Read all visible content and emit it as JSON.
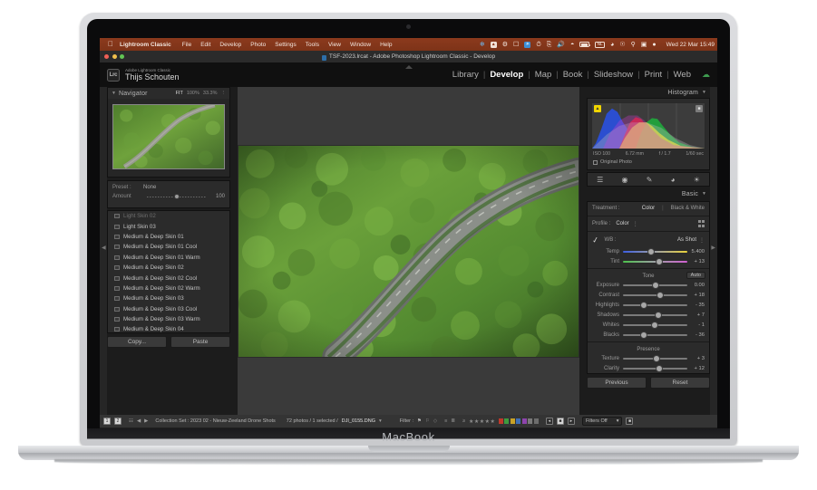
{
  "device": {
    "brand": "MacBook"
  },
  "menubar": {
    "apple_icon": "apple-icon",
    "app_name": "Lightroom Classic",
    "items": [
      "File",
      "Edit",
      "Develop",
      "Photo",
      "Settings",
      "Tools",
      "View",
      "Window",
      "Help"
    ],
    "status_icons": [
      "butterfly-icon",
      "dropbox-icon",
      "bluetooth-alt-icon",
      "screenshot-icon",
      "onedrive-icon",
      "timemachine-icon",
      "clipboard-icon",
      "volume-icon",
      "bluetooth-icon",
      "battery-icon",
      "input-language-nl",
      "wifi-icon",
      "controlcenter-icon",
      "search-icon",
      "displays-icon",
      "siri-icon"
    ],
    "input_language": "NL",
    "clock": "Wed 22 Mar  15:49"
  },
  "titlebar": {
    "title": "TSF-2023.lrcat - Adobe Photoshop Lightroom Classic - Develop"
  },
  "identity": {
    "logo_text": "Lrc",
    "product": "Adobe Lightroom Classic",
    "user": "Thijs Schouten"
  },
  "modules": {
    "items": [
      "Library",
      "Develop",
      "Map",
      "Book",
      "Slideshow",
      "Print",
      "Web"
    ],
    "active": "Develop",
    "cloud_icon": "cloud-sync-icon"
  },
  "left_panel": {
    "navigator": {
      "title": "Navigator",
      "zoom_options": [
        "FIT",
        "100%",
        "33.3%"
      ],
      "active_zoom": "FIT"
    },
    "presets_panel": {
      "preset_label": "Preset :",
      "preset_value": "None",
      "amount_label": "Amount",
      "amount_value": "100"
    },
    "preset_list": [
      {
        "label": "Light Skin 02",
        "faded": true
      },
      {
        "label": "Light Skin 03",
        "faded": false
      },
      {
        "label": "Medium & Deep Skin 01",
        "faded": false
      },
      {
        "label": "Medium & Deep Skin 01 Cool",
        "faded": false
      },
      {
        "label": "Medium & Deep Skin 01 Warm",
        "faded": false
      },
      {
        "label": "Medium & Deep Skin 02",
        "faded": false
      },
      {
        "label": "Medium & Deep Skin 02 Cool",
        "faded": false
      },
      {
        "label": "Medium & Deep Skin 02 Warm",
        "faded": false
      },
      {
        "label": "Medium & Deep Skin 03",
        "faded": false
      },
      {
        "label": "Medium & Deep Skin 03 Cool",
        "faded": false
      },
      {
        "label": "Medium & Deep Skin 03 Warm",
        "faded": false
      },
      {
        "label": "Medium & Deep Skin 04",
        "faded": false
      }
    ],
    "buttons": {
      "copy": "Copy...",
      "paste": "Paste"
    }
  },
  "right_panel": {
    "histogram": {
      "title": "Histogram",
      "iso": "ISO 100",
      "focal": "6.72 mm",
      "aperture": "f / 1.7",
      "shutter": "1/60 sec",
      "original_photo": "Original Photo",
      "clip_left_icon": "shadow-clipping-icon",
      "clip_right_icon": "highlight-clipping-icon"
    },
    "tools": [
      "crop-tool-icon",
      "spot-removal-icon",
      "masking-brush-icon",
      "red-eye-icon",
      "radial-filter-icon"
    ],
    "basic": {
      "title": "Basic",
      "treatment_label": "Treatment :",
      "treatment_color": "Color",
      "treatment_bw": "Black & White",
      "profile_label": "Profile :",
      "profile_value": "Color",
      "wb_label": "WB :",
      "wb_value": "As Shot",
      "eyedropper_icon": "eyedropper-icon",
      "wb_sliders": [
        {
          "label": "Temp",
          "value": "5.400",
          "pos": 43,
          "track": "temp"
        },
        {
          "label": "Tint",
          "value": "+ 13",
          "pos": 57,
          "track": "tint"
        }
      ],
      "tone_title": "Tone",
      "auto_label": "Auto",
      "tone_sliders": [
        {
          "label": "Exposure",
          "value": "0.00",
          "pos": 50,
          "track": "solid"
        },
        {
          "label": "Contrast",
          "value": "+ 18",
          "pos": 58,
          "track": "solid"
        },
        {
          "label": "Highlights",
          "value": "- 35",
          "pos": 33,
          "track": "solid"
        },
        {
          "label": "Shadows",
          "value": "+ 7",
          "pos": 55,
          "track": "solid"
        },
        {
          "label": "Whites",
          "value": "- 1",
          "pos": 49,
          "track": "solid"
        },
        {
          "label": "Blacks",
          "value": "- 36",
          "pos": 32,
          "track": "solid"
        }
      ],
      "presence_title": "Presence",
      "presence_sliders": [
        {
          "label": "Texture",
          "value": "+ 3",
          "pos": 52,
          "track": "solid"
        },
        {
          "label": "Clarity",
          "value": "+ 12",
          "pos": 56,
          "track": "solid"
        }
      ]
    },
    "buttons": {
      "previous": "Previous",
      "reset": "Reset"
    }
  },
  "filmstrip_toolbar": {
    "grid_badges": [
      "1",
      "2"
    ],
    "view_icon": "grid-view-icon",
    "nav_back_icon": "arrow-left-icon",
    "nav_fwd_icon": "arrow-right-icon",
    "source": "Collection Set : 2023 02 - Nieuw-Zeeland Drone Shots",
    "count": "72 photos / 1 selected /",
    "filename": "DJI_0155.DNG",
    "filter_label": "Filter :",
    "flag_icons": [
      "flag-pick-icon",
      "flag-unflagged-icon",
      "flag-reject-icon"
    ],
    "sort_icons": [
      "sort-ascending-icon",
      "sort-descending-icon"
    ],
    "rating_prefix": "≥",
    "stars": 5,
    "color_swatches": [
      "#c0392b",
      "#3f9b3f",
      "#c9a227",
      "#3f6fb5",
      "#8e44ad",
      "#7a7a7a",
      "#6d6d6d"
    ],
    "filters_off": "Filters Off"
  },
  "filmstrip": {
    "thumbnails": [
      {
        "kind": "sea",
        "selected": false
      },
      {
        "kind": "sea",
        "selected": false
      },
      {
        "kind": "sea-dark",
        "selected": false
      },
      {
        "kind": "sea-dark",
        "selected": false
      },
      {
        "kind": "sea",
        "selected": false
      },
      {
        "kind": "forest-bright",
        "selected": false
      },
      {
        "kind": "forest",
        "selected": false
      },
      {
        "kind": "forest-light",
        "selected": false
      },
      {
        "kind": "forest-light",
        "selected": false
      },
      {
        "kind": "forest-light",
        "selected": false
      },
      {
        "kind": "forest",
        "selected": false
      },
      {
        "kind": "forest",
        "selected": false
      },
      {
        "kind": "forest",
        "selected": false
      },
      {
        "kind": "forest-road",
        "selected": true
      },
      {
        "kind": "forest-road",
        "selected": false
      },
      {
        "kind": "forest-road",
        "selected": false
      },
      {
        "kind": "rock",
        "selected": false
      },
      {
        "kind": "rock",
        "selected": false
      },
      {
        "kind": "coast",
        "selected": false
      },
      {
        "kind": "coast-pale",
        "selected": false
      },
      {
        "kind": "coast-pale",
        "selected": false
      },
      {
        "kind": "mountain",
        "selected": false
      },
      {
        "kind": "mountain",
        "selected": false
      },
      {
        "kind": "mountain",
        "selected": false
      },
      {
        "kind": "lake",
        "selected": false
      },
      {
        "kind": "lake-pale",
        "selected": false
      },
      {
        "kind": "lake",
        "selected": false
      },
      {
        "kind": "lake",
        "selected": false
      }
    ]
  },
  "colors": {
    "menubar_bg": "#7d3318",
    "panel_bg": "#2b2b2b",
    "center_bg": "#3a3a3a",
    "accent_green": "#3e9b4f"
  }
}
